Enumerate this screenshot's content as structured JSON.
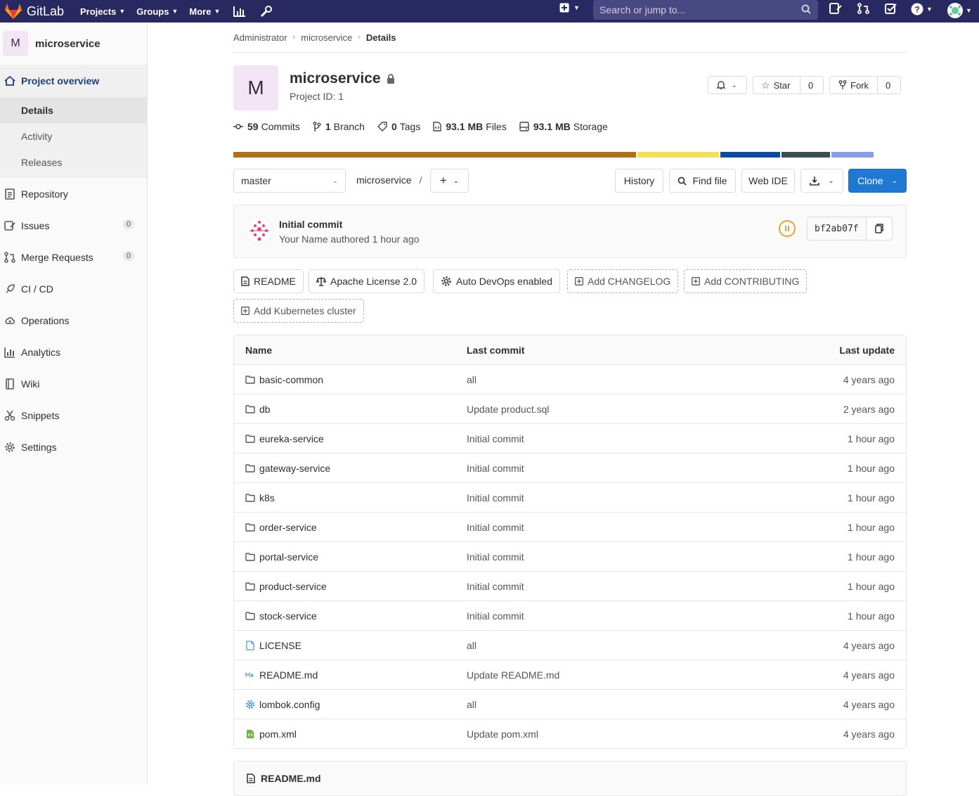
{
  "topbar": {
    "brand": "GitLab",
    "nav": [
      "Projects",
      "Groups",
      "More"
    ],
    "search_placeholder": "Search or jump to...",
    "bg_color": "#292961"
  },
  "sidebar": {
    "project_initial": "M",
    "project_name": "microservice",
    "overview_label": "Project overview",
    "sub_items": [
      "Details",
      "Activity",
      "Releases"
    ],
    "items": [
      {
        "label": "Repository",
        "icon": "doc-icon"
      },
      {
        "label": "Issues",
        "icon": "issues-icon",
        "badge": "0"
      },
      {
        "label": "Merge Requests",
        "icon": "merge-icon",
        "badge": "0"
      },
      {
        "label": "CI / CD",
        "icon": "rocket-icon"
      },
      {
        "label": "Operations",
        "icon": "cloud-icon"
      },
      {
        "label": "Analytics",
        "icon": "chart-icon"
      },
      {
        "label": "Wiki",
        "icon": "book-icon"
      },
      {
        "label": "Snippets",
        "icon": "scissors-icon"
      },
      {
        "label": "Settings",
        "icon": "gear-icon"
      }
    ]
  },
  "breadcrumb": [
    "Administrator",
    "microservice",
    "Details"
  ],
  "project": {
    "initial": "M",
    "title": "microservice",
    "id_text": "Project ID: 1",
    "star_label": "Star",
    "star_count": "0",
    "fork_label": "Fork",
    "fork_count": "0"
  },
  "stats": [
    {
      "num": "59",
      "label": "Commits"
    },
    {
      "num": "1",
      "label": "Branch"
    },
    {
      "num": "0",
      "label": "Tags"
    },
    {
      "num": "93.1 MB",
      "label": "Files"
    },
    {
      "num": "93.1 MB",
      "label": "Storage"
    }
  ],
  "languages": [
    {
      "color": "#b07219",
      "share": 0.63
    },
    {
      "color": "#f1e05a",
      "share": 0.128
    },
    {
      "color": "#0e4ba0",
      "share": 0.094
    },
    {
      "color": "#384d54",
      "share": 0.076
    },
    {
      "color": "#8a9be8",
      "share": 0.066
    }
  ],
  "toolbar": {
    "branch": "master",
    "path": "microservice",
    "path_sep": "/",
    "history": "History",
    "find_file": "Find file",
    "web_ide": "Web IDE",
    "clone": "Clone",
    "clone_color": "#1f78d1"
  },
  "commit": {
    "title": "Initial commit",
    "meta": "Your Name authored 1 hour ago",
    "sha": "bf2ab07f"
  },
  "quick_buttons": [
    {
      "label": "README",
      "dashed": false
    },
    {
      "label": "Apache License 2.0",
      "dashed": false
    },
    {
      "label": "Auto DevOps enabled",
      "dashed": false
    },
    {
      "label": "Add CHANGELOG",
      "dashed": true
    },
    {
      "label": "Add CONTRIBUTING",
      "dashed": true
    },
    {
      "label": "Add Kubernetes cluster",
      "dashed": true
    }
  ],
  "files": {
    "headers": [
      "Name",
      "Last commit",
      "Last update"
    ],
    "rows": [
      {
        "name": "basic-common",
        "type": "folder",
        "commit": "all",
        "updated": "4 years ago"
      },
      {
        "name": "db",
        "type": "folder",
        "commit": "Update product.sql",
        "updated": "2 years ago"
      },
      {
        "name": "eureka-service",
        "type": "folder",
        "commit": "Initial commit",
        "updated": "1 hour ago"
      },
      {
        "name": "gateway-service",
        "type": "folder",
        "commit": "Initial commit",
        "updated": "1 hour ago"
      },
      {
        "name": "k8s",
        "type": "folder",
        "commit": "Initial commit",
        "updated": "1 hour ago"
      },
      {
        "name": "order-service",
        "type": "folder",
        "commit": "Initial commit",
        "updated": "1 hour ago"
      },
      {
        "name": "portal-service",
        "type": "folder",
        "commit": "Initial commit",
        "updated": "1 hour ago"
      },
      {
        "name": "product-service",
        "type": "folder",
        "commit": "Initial commit",
        "updated": "1 hour ago"
      },
      {
        "name": "stock-service",
        "type": "folder",
        "commit": "Initial commit",
        "updated": "1 hour ago"
      },
      {
        "name": "LICENSE",
        "type": "license",
        "commit": "all",
        "updated": "4 years ago"
      },
      {
        "name": "README.md",
        "type": "markdown",
        "commit": "Update README.md",
        "updated": "4 years ago"
      },
      {
        "name": "lombok.config",
        "type": "config",
        "commit": "all",
        "updated": "4 years ago"
      },
      {
        "name": "pom.xml",
        "type": "xml",
        "commit": "Update pom.xml",
        "updated": "4 years ago"
      }
    ]
  },
  "readme_title": "README.md"
}
